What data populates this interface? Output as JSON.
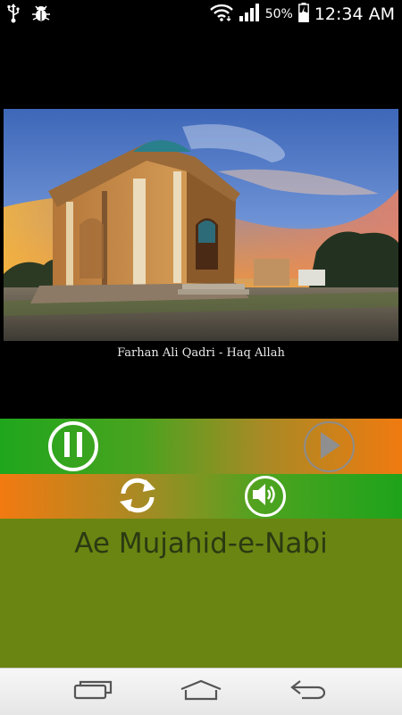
{
  "status_bar": {
    "battery_percent": "50%",
    "time": "12:34 AM",
    "icons": [
      "usb-icon",
      "bug-icon",
      "wifi-icon",
      "signal-icon",
      "battery-charging-icon"
    ]
  },
  "video": {
    "caption": "Farhan Ali Qadri  - Haq Allah"
  },
  "controls": {
    "pause": "pause-icon",
    "play": "play-icon",
    "repeat": "repeat-icon",
    "volume": "volume-icon"
  },
  "track": {
    "title": "Ae Mujahid-e-Nabi"
  },
  "nav": {
    "icons": [
      "recent-apps-icon",
      "home-icon",
      "back-icon"
    ]
  },
  "colors": {
    "green": "#1fa61d",
    "orange": "#f07a10",
    "olive": "#6b8512",
    "title_text": "#2b3a12"
  }
}
